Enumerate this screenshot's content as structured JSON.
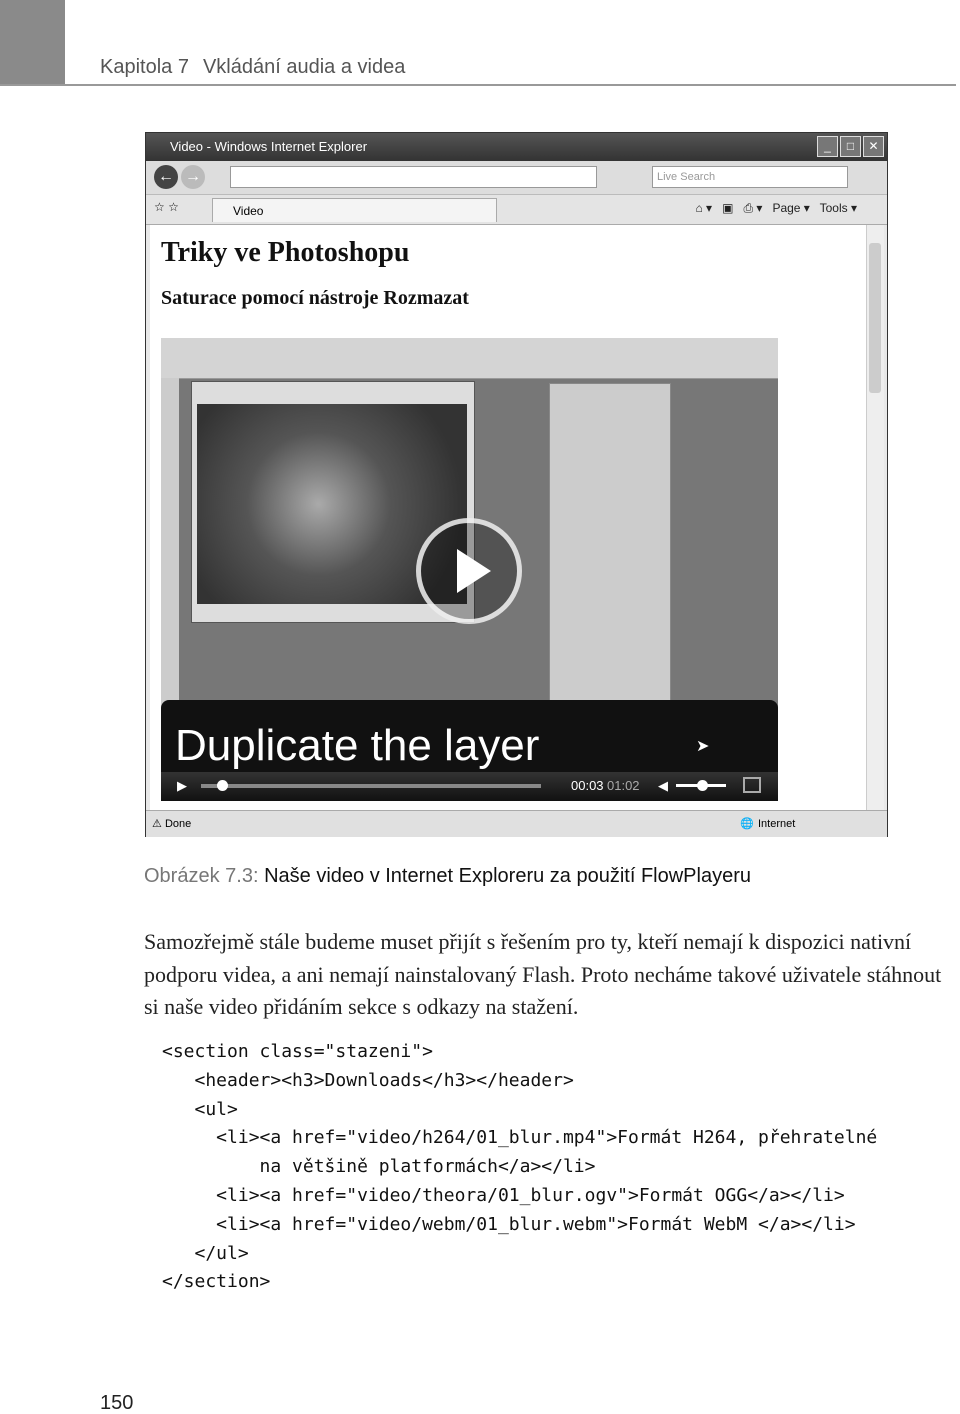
{
  "header": {
    "chapter": "Kapitola 7",
    "title": "Vkládání audia a videa"
  },
  "browser": {
    "window_title": "Video - Windows Internet Explorer",
    "search_placeholder": "Live Search",
    "tab_label": "Video",
    "toolbar": {
      "page": "Page ▾",
      "tools": "Tools ▾"
    },
    "status_left": "Done",
    "status_right": "Internet"
  },
  "webpage": {
    "heading": "Triky ve Photoshopu",
    "subheading": "Saturace pomocí nástroje Rozmazat"
  },
  "video": {
    "caption": "Duplicate the layer",
    "time_current": "00:03",
    "time_total": "01:02",
    "progress": 0.05,
    "volume": 0.5
  },
  "figure": {
    "label": "Obrázek 7.3:",
    "text": "Naše video v Internet Exploreru za použití FlowPlayeru"
  },
  "paragraph": "Samozřejmě stále budeme muset přijít s řešením pro ty, kteří nemají k dispozici nativní podporu videa, a ani nemají nainstalovaný Flash. Proto necháme takové uživatele stáhnout si naše video přidáním sekce s odkazy na stažení.",
  "code": [
    "<section class=\"stazeni\">",
    "   <header><h3>Downloads</h3></header>",
    "   <ul>",
    "     <li><a href=\"video/h264/01_blur.mp4\">Formát H264, přehratelné",
    "         na většině platformách</a></li>",
    "     <li><a href=\"video/theora/01_blur.ogv\">Formát OGG</a></li>",
    "     <li><a href=\"video/webm/01_blur.webm\">Formát WebM </a></li>",
    "   </ul>",
    "</section>"
  ],
  "page_number": "150"
}
